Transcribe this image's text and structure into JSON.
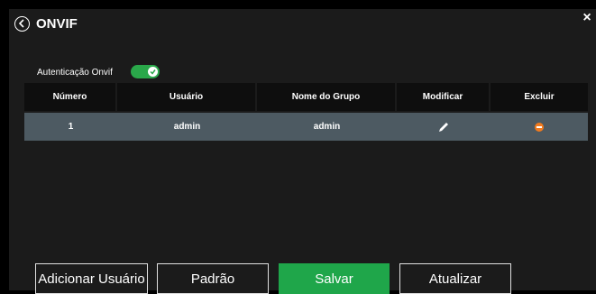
{
  "dialog": {
    "title": "ONVIF",
    "close_label": "×"
  },
  "auth": {
    "label": "Autenticação Onvif",
    "enabled": true
  },
  "table": {
    "headers": [
      "Número",
      "Usuário",
      "Nome do Grupo",
      "Modificar",
      "Excluir"
    ],
    "rows": [
      {
        "number": "1",
        "user": "admin",
        "group": "admin"
      }
    ]
  },
  "buttons": {
    "add_user": "Adicionar Usuário",
    "default": "Padrão",
    "save": "Salvar",
    "refresh": "Atualizar"
  },
  "colors": {
    "accent_green": "#1fa64a",
    "row_bg": "#4d5a62",
    "delete_orange": "#f07a1e"
  },
  "icons": {
    "back": "back-circle-icon",
    "close": "close-icon",
    "edit": "pencil-icon",
    "delete": "minus-circle-icon",
    "toggle_check": "check-icon"
  }
}
